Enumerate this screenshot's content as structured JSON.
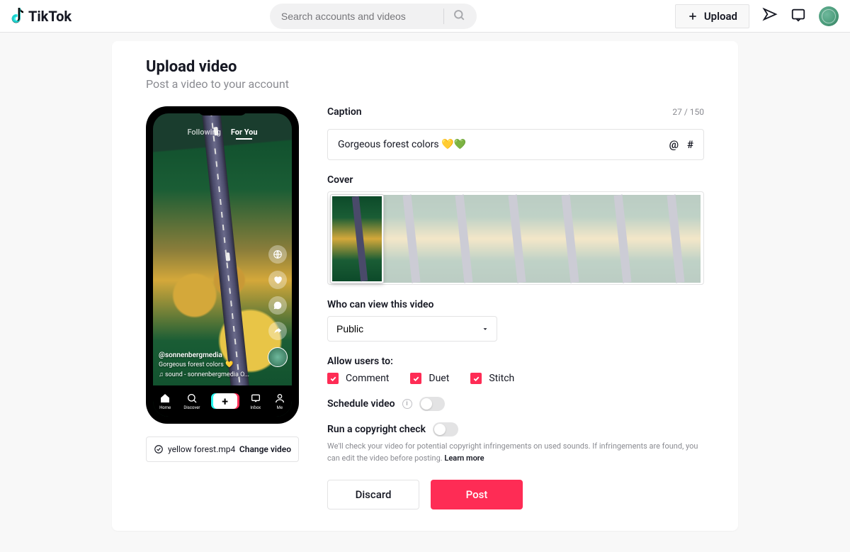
{
  "header": {
    "brand": "TikTok",
    "search_placeholder": "Search accounts and videos",
    "upload_label": "Upload"
  },
  "page": {
    "title": "Upload video",
    "subtitle": "Post a video to your account"
  },
  "preview": {
    "tab_following": "Following",
    "tab_foryou": "For You",
    "username": "@sonnenbergmedia",
    "caption_line": "Gorgeous forest colors 💛",
    "sound_line": "♫  sound - sonnenbergmedia  O...",
    "nav": {
      "home": "Home",
      "discover": "Discover",
      "inbox": "Inbox",
      "me": "Me"
    }
  },
  "file": {
    "name": "yellow forest.mp4",
    "change_label": "Change video"
  },
  "caption": {
    "label": "Caption",
    "text": "Gorgeous forest colors 💛💚",
    "count": "27 / 150"
  },
  "cover": {
    "label": "Cover"
  },
  "visibility": {
    "label": "Who can view this video",
    "value": "Public"
  },
  "allow": {
    "label": "Allow users to:",
    "comment": "Comment",
    "duet": "Duet",
    "stitch": "Stitch"
  },
  "schedule": {
    "label": "Schedule video"
  },
  "copyright": {
    "label": "Run a copyright check",
    "helper_a": "We'll check your video for potential copyright infringements on used sounds. If infringements are found, you can edit the video before posting. ",
    "learn": "Learn more"
  },
  "buttons": {
    "discard": "Discard",
    "post": "Post"
  }
}
